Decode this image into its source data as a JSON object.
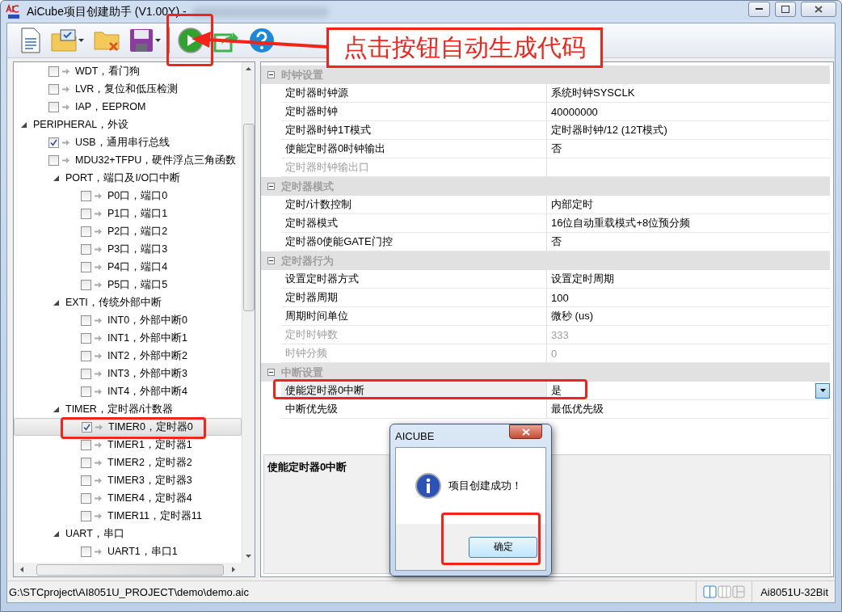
{
  "window": {
    "title": "AiCube项目创建助手 (V1.00Y) -"
  },
  "toolbar": {
    "buttons": [
      {
        "kind": "new"
      },
      {
        "kind": "open",
        "menu": true
      },
      {
        "kind": "close"
      },
      {
        "kind": "save",
        "menu": true
      },
      {
        "kind": "separator"
      },
      {
        "kind": "run"
      },
      {
        "kind": "export"
      },
      {
        "kind": "help"
      }
    ]
  },
  "tree": [
    {
      "kind": "tail",
      "children": [
        {
          "kind": "check",
          "label": "WDT，看门狗",
          "checked": false,
          "selected": false
        },
        {
          "kind": "check",
          "label": "LVR，复位和低压检测",
          "checked": false,
          "selected": false
        },
        {
          "kind": "check",
          "label": "IAP，EEPROM",
          "checked": false,
          "selected": false
        }
      ]
    },
    {
      "kind": "group",
      "label": "PERIPHERAL，外设",
      "expanded": true,
      "selected": false,
      "children": [
        {
          "kind": "check",
          "label": "USB，通用串行总线",
          "checked": true,
          "selected": false
        },
        {
          "kind": "check",
          "label": "MDU32+TFPU，硬件浮点三角函数",
          "checked": false,
          "selected": false
        },
        {
          "kind": "group",
          "label": "PORT，端口及I/O口中断",
          "expanded": true,
          "selected": false,
          "children": [
            {
              "kind": "check",
              "label": "P0口，端口0",
              "checked": false,
              "selected": false
            },
            {
              "kind": "check",
              "label": "P1口，端口1",
              "checked": false,
              "selected": false
            },
            {
              "kind": "check",
              "label": "P2口，端口2",
              "checked": false,
              "selected": false
            },
            {
              "kind": "check",
              "label": "P3口，端口3",
              "checked": false,
              "selected": false
            },
            {
              "kind": "check",
              "label": "P4口，端口4",
              "checked": false,
              "selected": false
            },
            {
              "kind": "check",
              "label": "P5口，端口5",
              "checked": false,
              "selected": false
            }
          ]
        },
        {
          "kind": "group",
          "label": "EXTI，传统外部中断",
          "expanded": true,
          "selected": false,
          "children": [
            {
              "kind": "check",
              "label": "INT0，外部中断0",
              "checked": false,
              "selected": false
            },
            {
              "kind": "check",
              "label": "INT1，外部中断1",
              "checked": false,
              "selected": false
            },
            {
              "kind": "check",
              "label": "INT2，外部中断2",
              "checked": false,
              "selected": false
            },
            {
              "kind": "check",
              "label": "INT3，外部中断3",
              "checked": false,
              "selected": false
            },
            {
              "kind": "check",
              "label": "INT4，外部中断4",
              "checked": false,
              "selected": false
            }
          ]
        },
        {
          "kind": "group",
          "label": "TIMER，定时器/计数器",
          "expanded": true,
          "selected": false,
          "children": [
            {
              "kind": "check",
              "label": "TIMER0，定时器0",
              "checked": true,
              "selected": true
            },
            {
              "kind": "check",
              "label": "TIMER1，定时器1",
              "checked": false,
              "selected": false
            },
            {
              "kind": "check",
              "label": "TIMER2，定时器2",
              "checked": false,
              "selected": false
            },
            {
              "kind": "check",
              "label": "TIMER3，定时器3",
              "checked": false,
              "selected": false
            },
            {
              "kind": "check",
              "label": "TIMER4，定时器4",
              "checked": false,
              "selected": false
            },
            {
              "kind": "check",
              "label": "TIMER11，定时器11",
              "checked": false,
              "selected": false
            }
          ]
        },
        {
          "kind": "group",
          "label": "UART，串口",
          "expanded": true,
          "selected": false,
          "children": [
            {
              "kind": "check",
              "label": "UART1，串口1",
              "checked": false,
              "selected": false
            }
          ]
        }
      ]
    }
  ],
  "properties": [
    {
      "category": "时钟设置",
      "expanded": true,
      "rows": [
        {
          "name": "定时器时钟源",
          "value": "系统时钟SYSCLK",
          "disabled": false,
          "selected": false
        },
        {
          "name": "定时器时钟",
          "value": "40000000",
          "disabled": false,
          "selected": false
        },
        {
          "name": "定时器时钟1T模式",
          "value": "定时器时钟/12 (12T模式)",
          "disabled": false,
          "selected": false
        },
        {
          "name": "使能定时器0时钟输出",
          "value": "否",
          "disabled": false,
          "selected": false
        },
        {
          "name": "定时器时钟输出口",
          "disabled": true,
          "selected": false
        }
      ]
    },
    {
      "category": "定时器模式",
      "expanded": true,
      "rows": [
        {
          "name": "定时/计数控制",
          "value": "内部定时",
          "disabled": false,
          "selected": false
        },
        {
          "name": "定时器模式",
          "value": "16位自动重载模式+8位预分频",
          "disabled": false,
          "selected": false
        },
        {
          "name": "定时器0使能GATE门控",
          "value": "否",
          "disabled": false,
          "selected": false
        }
      ]
    },
    {
      "category": "定时器行为",
      "expanded": true,
      "rows": [
        {
          "name": "设置定时器方式",
          "value": "设置定时周期",
          "disabled": false,
          "selected": false
        },
        {
          "name": "定时器周期",
          "value": "100",
          "disabled": false,
          "selected": false
        },
        {
          "name": "周期时间单位",
          "value": "微秒 (us)",
          "disabled": false,
          "selected": false
        },
        {
          "name": "定时时钟数",
          "value": "333",
          "disabled": true,
          "selected": false
        },
        {
          "name": "时钟分频",
          "value": "0",
          "disabled": true,
          "selected": false
        }
      ]
    },
    {
      "category": "中断设置",
      "expanded": true,
      "rows": [
        {
          "name": "使能定时器0中断",
          "value": "是",
          "disabled": false,
          "selected": true
        },
        {
          "name": "中断优先级",
          "value": "最低优先级",
          "disabled": false,
          "selected": false
        }
      ]
    }
  ],
  "description": {
    "title": "使能定时器0中断"
  },
  "status_bar": {
    "path": "G:\\STCproject\\AI8051U_PROJECT\\demo\\demo.aic",
    "device": "Ai8051U-32Bit"
  },
  "dialog": {
    "title": "AICUBE",
    "message": "项目创建成功！",
    "button": "确定"
  },
  "annotation": {
    "callout": "点击按钮自动生成代码"
  }
}
